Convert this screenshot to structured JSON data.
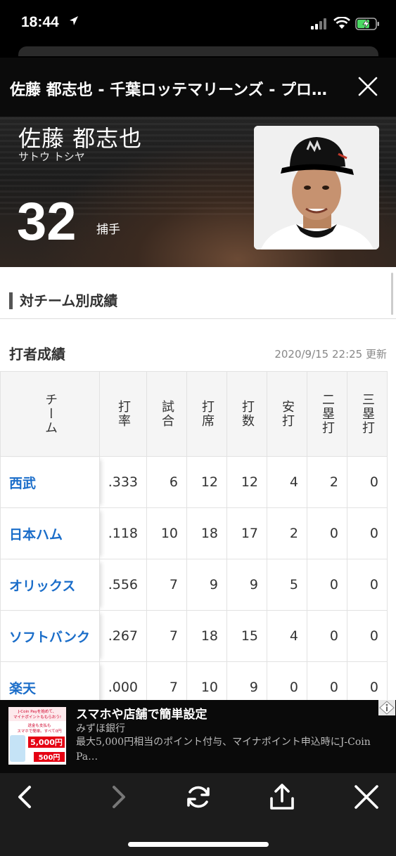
{
  "status_bar": {
    "time": "18:44"
  },
  "header": {
    "title": "佐藤 都志也 - 千葉ロッテマリーンズ - プロ野球 - スポーツナビ"
  },
  "player": {
    "name": "佐藤 都志也",
    "kana": "サトウ トシヤ",
    "number": "32",
    "position": "捕手"
  },
  "section_title": "対チーム別成績",
  "batting": {
    "title": "打者成績",
    "updated": "2020/9/15 22:25 更新",
    "columns": [
      "チーム",
      "打率",
      "試合",
      "打席",
      "打数",
      "安打",
      "二塁打",
      "三塁打"
    ],
    "rows": [
      [
        "西武",
        ".333",
        "6",
        "12",
        "12",
        "4",
        "2",
        "0"
      ],
      [
        "日本ハム",
        ".118",
        "10",
        "18",
        "17",
        "2",
        "0",
        "0"
      ],
      [
        "オリックス",
        ".556",
        "7",
        "9",
        "9",
        "5",
        "0",
        "0"
      ],
      [
        "ソフトバンク",
        ".267",
        "7",
        "18",
        "15",
        "4",
        "0",
        "0"
      ],
      [
        "楽天",
        ".000",
        "7",
        "10",
        "9",
        "0",
        "0",
        "0"
      ]
    ]
  },
  "ad": {
    "headline": "スマホや店舗で簡単設定",
    "sponsor": "みずほ銀行",
    "description": "最大5,000円相当のポイント付与、マイナポイント申込時にJ-Coin Pa…",
    "thumb": {
      "line1": "J-Coin Payを始めて、",
      "line2": "マイナポイントももらおう!",
      "line3": "送金も支払も",
      "line4": "スマホで簡単。すべて0円",
      "amount1": "5,000円",
      "amount2": "500円"
    }
  },
  "colors": {
    "team_link": "#1a6dc9",
    "toolbar": "#1c1c1c",
    "header": "#0b0b0b"
  }
}
